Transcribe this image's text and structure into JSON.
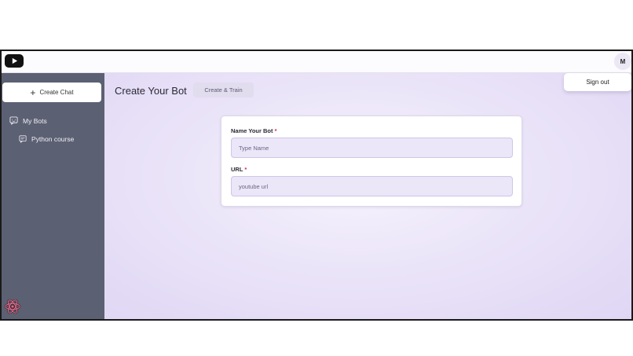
{
  "header": {
    "logo_icon": "youtube-play-icon",
    "avatar_initial": "M",
    "menu": {
      "signout_label": "Sign out"
    }
  },
  "sidebar": {
    "create_chat_label": "Create Chat",
    "items": [
      {
        "label": "My Bots",
        "icon": "chat-bubble-icon"
      },
      {
        "label": "Python course",
        "icon": "message-icon"
      }
    ],
    "footer_icon": "react-logo-icon"
  },
  "main": {
    "title": "Create Your Bot",
    "create_train_label": "Create & Train",
    "form": {
      "name_label": "Name Your Bot",
      "name_required": "*",
      "name_placeholder": "Type Name",
      "name_value": "",
      "url_label": "URL",
      "url_required": "*",
      "url_placeholder": "youtube url",
      "url_value": ""
    }
  },
  "colors": {
    "sidebar_bg": "#5c6073",
    "main_bg": "#e6e0f6",
    "required": "#c0304a"
  }
}
